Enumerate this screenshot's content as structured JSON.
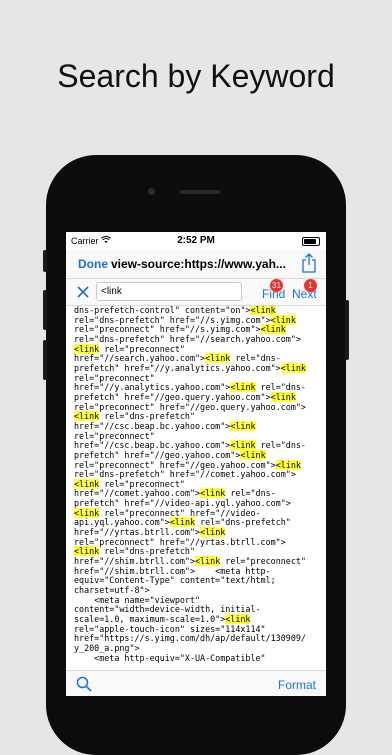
{
  "promo": {
    "headline": "Search by Keyword"
  },
  "status": {
    "carrier": "Carrier",
    "time": "2:52 PM"
  },
  "nav": {
    "done": "Done",
    "title": "view-source:https://www.yah..."
  },
  "find": {
    "query": "<link",
    "find_label": "Find",
    "next_label": "Next",
    "find_count": "31",
    "next_count": "1"
  },
  "source_lines": [
    [
      [
        "dns-prefetch-control\" content=\"on\">",
        false
      ],
      [
        "<link",
        true
      ]
    ],
    [
      [
        "rel=\"dns-prefetch\" href=\"//s.yimg.com\">",
        false
      ],
      [
        "<link",
        true
      ]
    ],
    [
      [
        "rel=\"preconnect\" href=\"//s.yimg.com\">",
        false
      ],
      [
        "<link",
        true
      ]
    ],
    [
      [
        "rel=\"dns-prefetch\" href=\"//search.yahoo.com\">",
        false
      ]
    ],
    [
      [
        "<link",
        true
      ],
      [
        " rel=\"preconnect\"",
        false
      ]
    ],
    [
      [
        "href=\"//search.yahoo.com\">",
        false
      ],
      [
        "<link",
        true
      ],
      [
        " rel=\"dns-",
        false
      ]
    ],
    [
      [
        "prefetch\" href=\"//y.analytics.yahoo.com\">",
        false
      ],
      [
        "<link",
        true
      ]
    ],
    [
      [
        "rel=\"preconnect\"",
        false
      ]
    ],
    [
      [
        "href=\"//y.analytics.yahoo.com\">",
        false
      ],
      [
        "<link",
        true
      ],
      [
        " rel=\"dns-",
        false
      ]
    ],
    [
      [
        "prefetch\" href=\"//geo.query.yahoo.com\">",
        false
      ],
      [
        "<link",
        true
      ]
    ],
    [
      [
        "rel=\"preconnect\" href=\"//geo.query.yahoo.com\">",
        false
      ]
    ],
    [
      [
        "<link",
        true
      ],
      [
        " rel=\"dns-prefetch\"",
        false
      ]
    ],
    [
      [
        "href=\"//csc.beap.bc.yahoo.com\">",
        false
      ],
      [
        "<link",
        true
      ]
    ],
    [
      [
        "rel=\"preconnect\"",
        false
      ]
    ],
    [
      [
        "href=\"//csc.beap.bc.yahoo.com\">",
        false
      ],
      [
        "<link",
        true
      ],
      [
        " rel=\"dns-",
        false
      ]
    ],
    [
      [
        "prefetch\" href=\"//geo.yahoo.com\">",
        false
      ],
      [
        "<link",
        true
      ]
    ],
    [
      [
        "rel=\"preconnect\" href=\"//geo.yahoo.com\">",
        false
      ],
      [
        "<link",
        true
      ]
    ],
    [
      [
        "rel=\"dns-prefetch\" href=\"//comet.yahoo.com\">",
        false
      ]
    ],
    [
      [
        "<link",
        true
      ],
      [
        " rel=\"preconnect\"",
        false
      ]
    ],
    [
      [
        "href=\"//comet.yahoo.com\">",
        false
      ],
      [
        "<link",
        true
      ],
      [
        " rel=\"dns-",
        false
      ]
    ],
    [
      [
        "prefetch\" href=\"//video-api.yql.yahoo.com\">",
        false
      ]
    ],
    [
      [
        "<link",
        true
      ],
      [
        " rel=\"preconnect\" href=\"//video-",
        false
      ]
    ],
    [
      [
        "api.yql.yahoo.com\">",
        false
      ],
      [
        "<link",
        true
      ],
      [
        " rel=\"dns-prefetch\"",
        false
      ]
    ],
    [
      [
        "href=\"//yrtas.btrll.com\">",
        false
      ],
      [
        "<link",
        true
      ]
    ],
    [
      [
        "rel=\"preconnect\" href=\"//yrtas.btrll.com\">",
        false
      ]
    ],
    [
      [
        "<link",
        true
      ],
      [
        " rel=\"dns-prefetch\"",
        false
      ]
    ],
    [
      [
        "href=\"//shim.btrll.com\">",
        false
      ],
      [
        "<link",
        true
      ],
      [
        " rel=\"preconnect\"",
        false
      ]
    ],
    [
      [
        "href=\"//shim.btrll.com\">    <meta http-",
        false
      ]
    ],
    [
      [
        "equiv=\"Content-Type\" content=\"text/html;",
        false
      ]
    ],
    [
      [
        "charset=utf-8\">",
        false
      ]
    ],
    [
      [
        "    <meta name=\"viewport\"",
        false
      ]
    ],
    [
      [
        "content=\"width=device-width, initial-",
        false
      ]
    ],
    [
      [
        "scale=1.0, maximum-scale=1.0\">",
        false
      ],
      [
        "<link",
        true
      ]
    ],
    [
      [
        "rel=\"apple-touch-icon\" sizes=\"114x114\"",
        false
      ]
    ],
    [
      [
        "href=\"https://s.yimg.com/dh/ap/default/130909/",
        false
      ]
    ],
    [
      [
        "y_200_a.png\">",
        false
      ]
    ],
    [
      [
        "    <meta http-equiv=\"X-UA-Compatible\"",
        false
      ]
    ]
  ],
  "bottom": {
    "format_label": "Format"
  },
  "colors": {
    "accent": "#1e6fd6",
    "highlight": "#ffff3a",
    "badge": "#e8352b"
  }
}
